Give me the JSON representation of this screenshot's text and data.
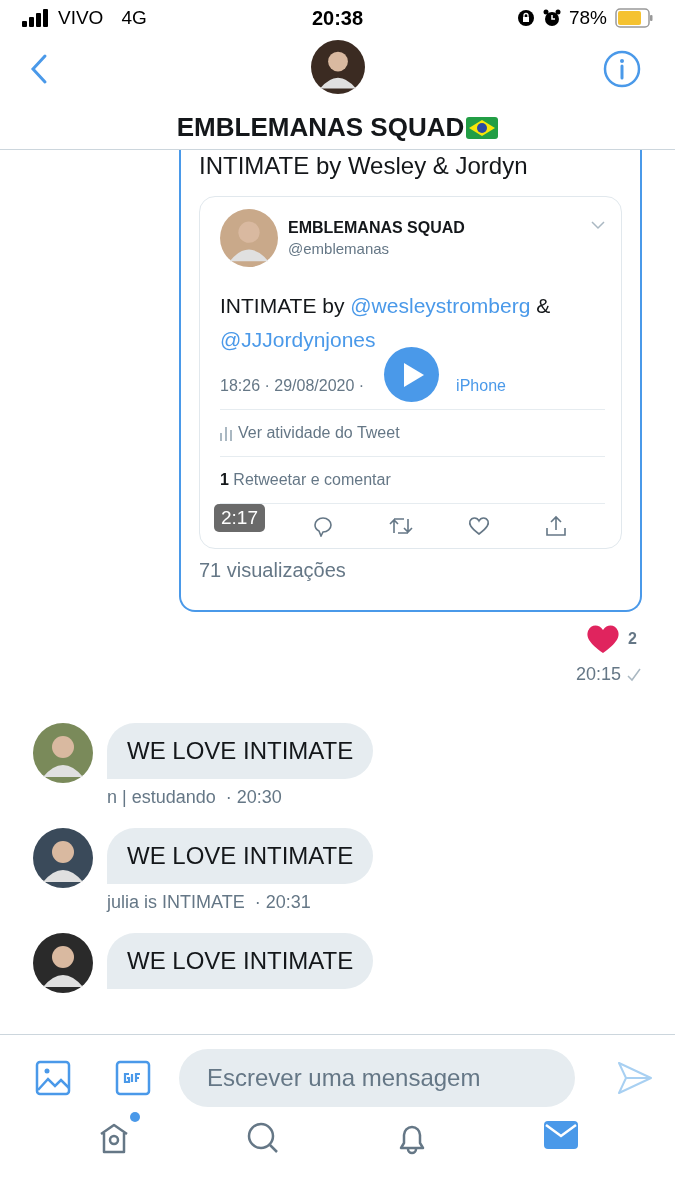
{
  "status_bar": {
    "carrier": "VIVO",
    "network": "4G",
    "time": "20:38",
    "battery": "78%"
  },
  "header": {
    "title": "EMBLEMANAS SQUAD"
  },
  "sent_message": {
    "text": "INTIMATE by Wesley & Jordyn",
    "embedded_tweet": {
      "name": "EMBLEMANAS SQUAD",
      "handle": "@emblemanas",
      "text_parts": [
        {
          "kind": "text",
          "text": "INTIMATE by "
        },
        {
          "kind": "mention",
          "text": "@wesleystromberg"
        },
        {
          "kind": "text",
          "text": " & "
        },
        {
          "kind": "mention",
          "text": "@JJJordynjones"
        }
      ],
      "timestamp": "18:26 · 29/08/2020 ·",
      "source": "iPhone",
      "activity": "Ver atividade do Tweet",
      "retweet_count": "1",
      "retweet_label": "Retweetar e comentar"
    },
    "video_duration": "2:17",
    "views": "71 visualizações",
    "reaction_count": "2",
    "time": "20:15",
    "delivered": true
  },
  "messages": [
    {
      "text": "WE LOVE INTIMATE",
      "author": "n | estudando",
      "time": "· 20:30"
    },
    {
      "text": "WE LOVE INTIMATE",
      "author": "julia is INTIMATE",
      "time": "· 20:31"
    },
    {
      "text": "WE LOVE INTIMATE"
    }
  ],
  "composer": {
    "placeholder": "Escrever uma mensagem"
  },
  "tab_bar": [
    {
      "kind": "home",
      "selected": false,
      "badge": true
    },
    {
      "kind": "search",
      "selected": false,
      "badge": false
    },
    {
      "kind": "notifications",
      "selected": false,
      "badge": false
    },
    {
      "kind": "messages",
      "selected": true,
      "badge": false
    }
  ]
}
